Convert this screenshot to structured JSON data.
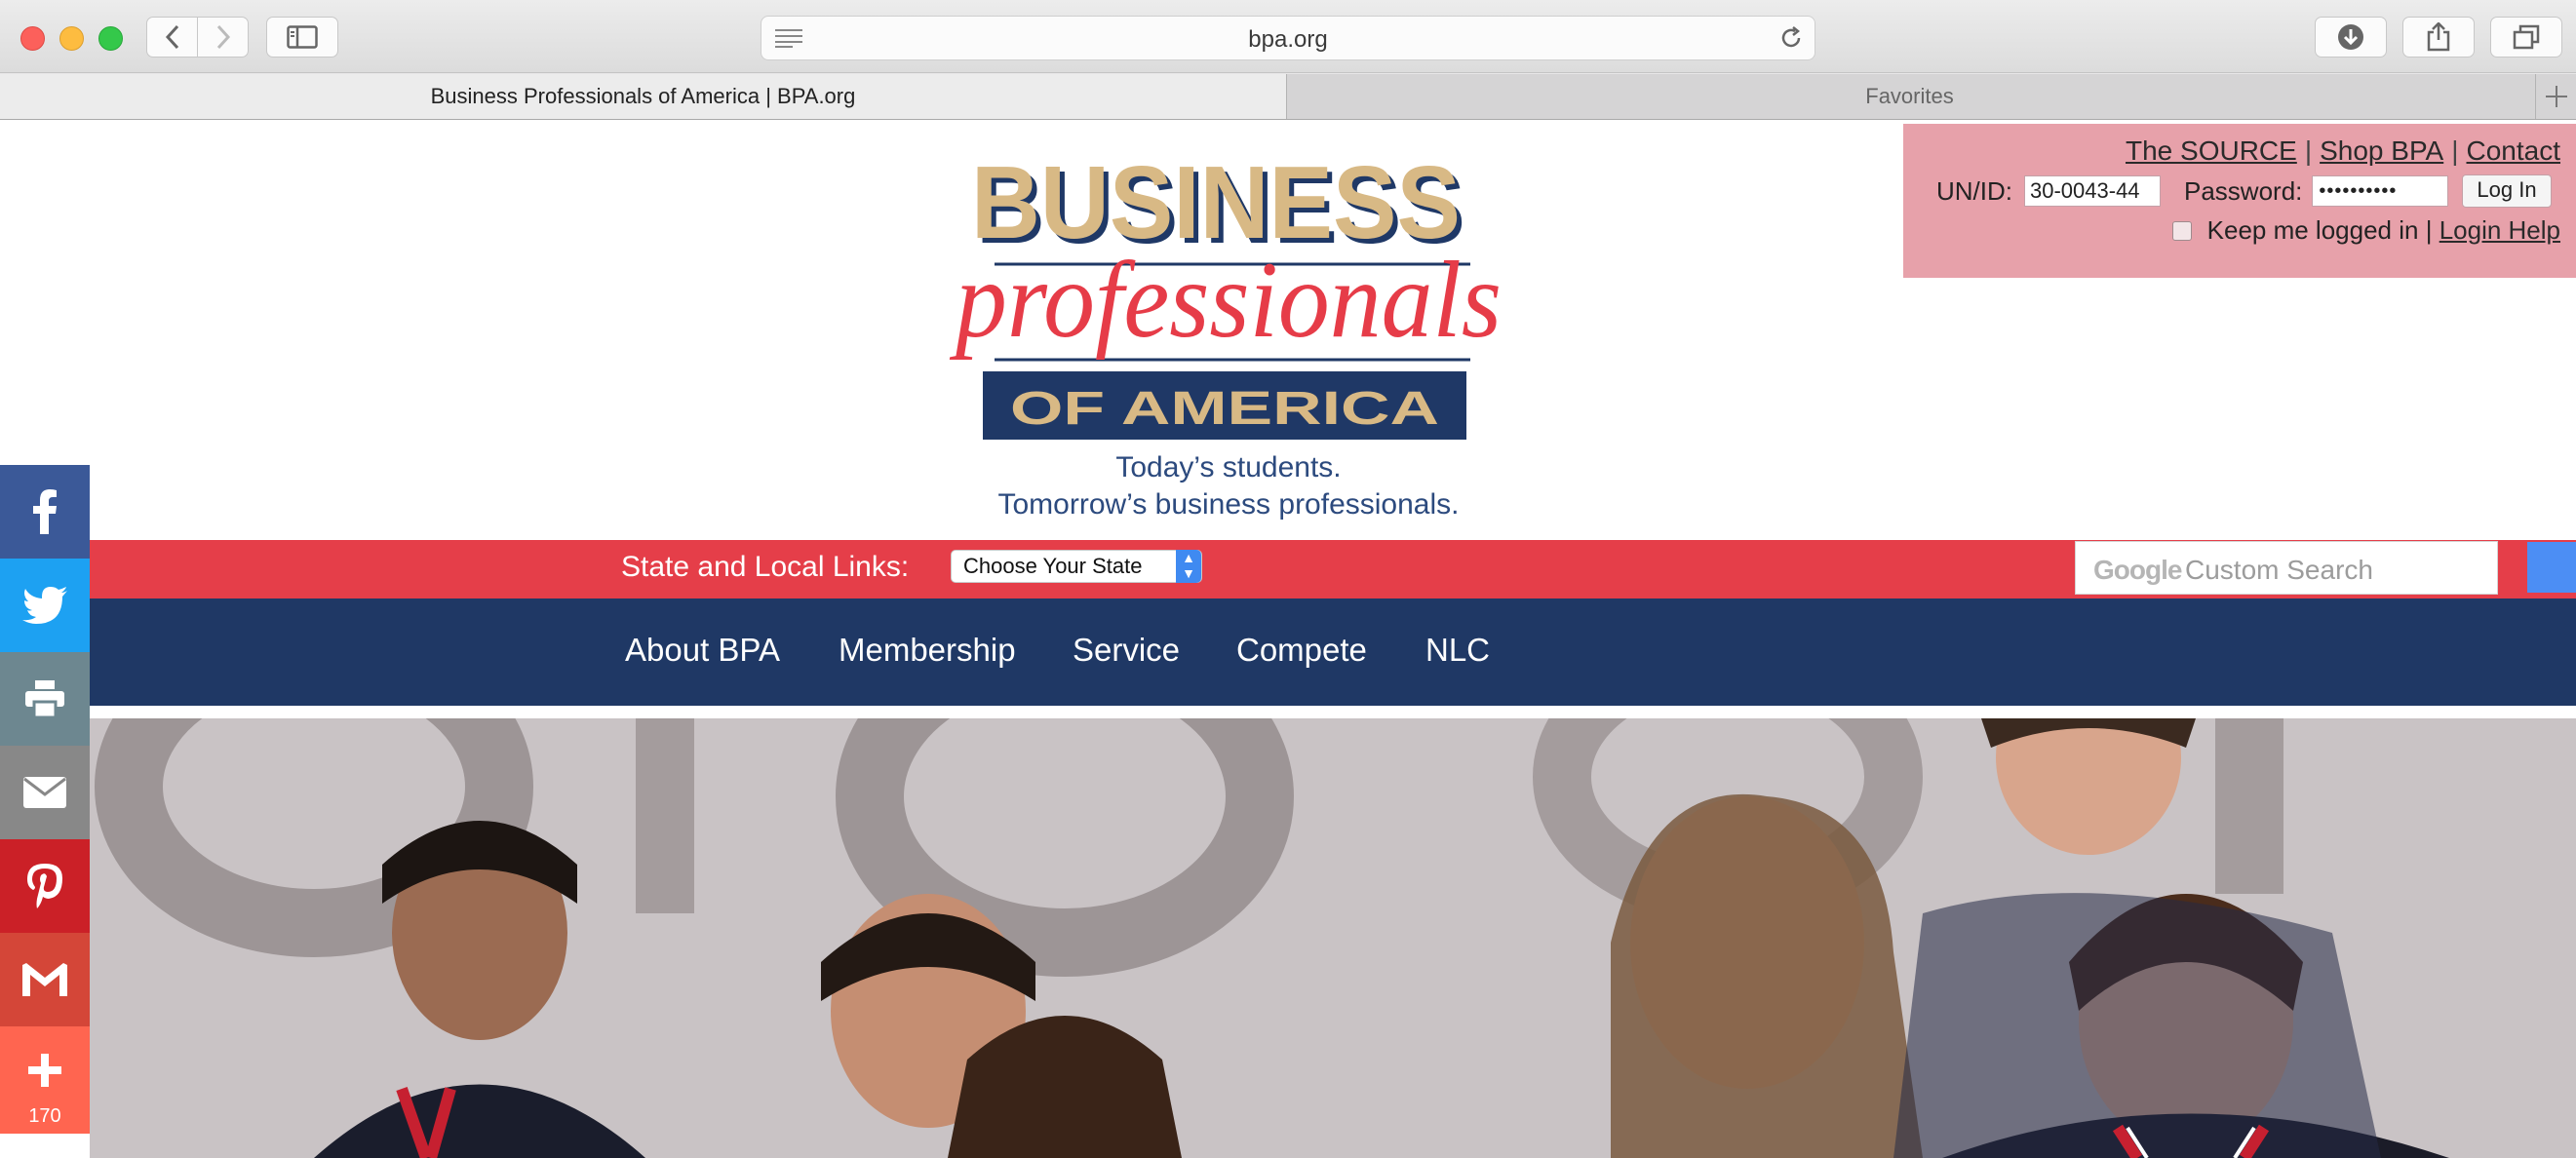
{
  "browser": {
    "url": "bpa.org",
    "tabs": [
      {
        "label": "Business Professionals of America | BPA.org"
      },
      {
        "label": "Favorites"
      }
    ]
  },
  "logo": {
    "word1": "BUSINESS",
    "word2": "professionals",
    "word3": "OF AMERICA",
    "tagline1": "Today’s students.",
    "tagline2": "Tomorrow’s business professionals."
  },
  "login": {
    "links": [
      "The SOURCE",
      "Shop BPA",
      "Contact"
    ],
    "separator": "|",
    "unid_label": "UN/ID:",
    "unid_value": "30-0043-44",
    "password_label": "Password:",
    "password_value": "••••••••••",
    "login_button": "Log In",
    "keep_logged_in": "Keep me logged in |",
    "login_help": "Login Help"
  },
  "state_links": {
    "label": "State and Local Links:",
    "selected": "Choose Your State"
  },
  "search": {
    "brand": "Google",
    "placeholder": "Custom Search"
  },
  "nav": {
    "items": [
      {
        "label": "About BPA"
      },
      {
        "label": "Membership"
      },
      {
        "label": "Service"
      },
      {
        "label": "Compete"
      },
      {
        "label": "NLC"
      }
    ]
  },
  "social": {
    "items": [
      {
        "name": "facebook",
        "color": "#3b5998"
      },
      {
        "name": "twitter",
        "color": "#1da1f2"
      },
      {
        "name": "print",
        "color": "#6d8790"
      },
      {
        "name": "email",
        "color": "#888888"
      },
      {
        "name": "pinterest",
        "color": "#cb2027"
      },
      {
        "name": "gmail",
        "color": "#d44638"
      },
      {
        "name": "share",
        "color": "#ff6550"
      }
    ],
    "share_count": "170"
  },
  "colors": {
    "red_bar": "#e53e49",
    "nav_bar": "#1f3865",
    "login_panel": "#e7a1aa"
  }
}
